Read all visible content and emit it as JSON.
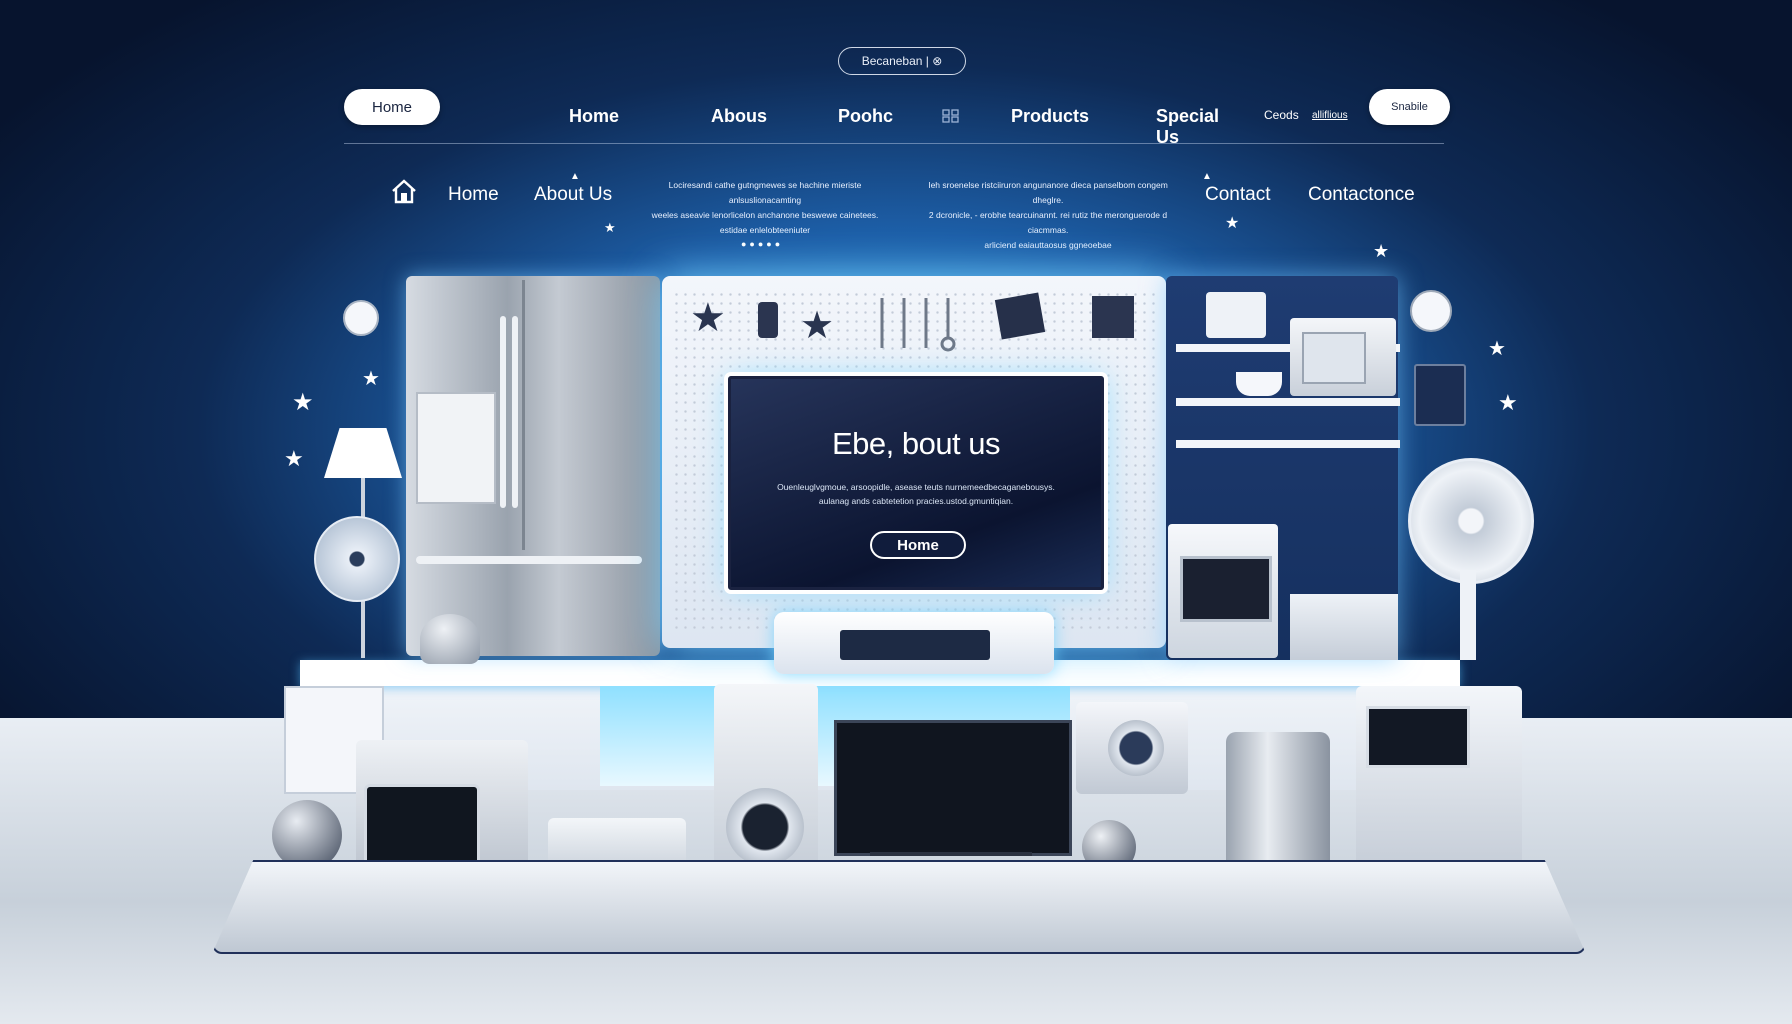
{
  "colors": {
    "accent": "#3aa8e8",
    "navy": "#0e2a55",
    "white": "#ffffff"
  },
  "topbar": {
    "badge_text": "Becaneban | ⊗",
    "left_button": "Home",
    "right_button": "Snabile",
    "nav": [
      "Home",
      "Abous",
      "Poohc",
      "Products",
      "Special Us"
    ],
    "extra_small": "Ceods",
    "extra_small2": "alliflious",
    "nav_icon": "grid-icon"
  },
  "subnav": {
    "home_icon": "home-icon",
    "items": [
      "Home",
      "About Us"
    ],
    "right_items": [
      "Contact",
      "Contactonce"
    ],
    "blurb_left": [
      "Lociresandi cathe gutngmewes se hachine mieriste anlsuslionacamting",
      "weeles aseavie lenorlicelon anchanone beswewe cainetees.",
      " estidae enlelobteeniuter"
    ],
    "blurb_right": [
      "Ieh sroenelse ristciiruron angunanore dieca panselbom congem dheglre.",
      "2 dcronicle, - erobhe tearcuinannt. rei rutiz the meronguerode d ciacmmas.",
      " arliciend eaiauttaosus ggneoebae"
    ]
  },
  "hero": {
    "title": "Ebe, bout us",
    "subtitle": [
      "Ouenleuglvgmoue, arsoopidle, asease teuts nurnemeedbecaganebousys.",
      "aulanag ands cabtetetion pracies.ustod.gmuntiqian."
    ],
    "button": "Home"
  }
}
